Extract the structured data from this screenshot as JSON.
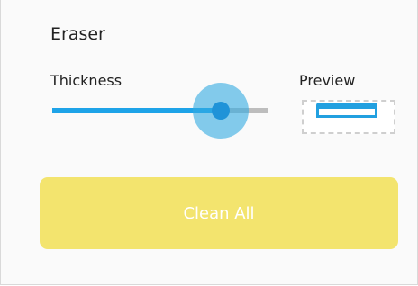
{
  "panel": {
    "title": "Eraser",
    "thickness": {
      "label": "Thickness",
      "value_fraction": 0.78
    },
    "preview": {
      "label": "Preview"
    },
    "clean_button": {
      "label": "Clean All"
    }
  },
  "colors": {
    "slider_fill": "#1ea3e8",
    "slider_track": "#bdbdbd",
    "button_bg": "#f3e46e",
    "button_text": "#ffffff"
  }
}
